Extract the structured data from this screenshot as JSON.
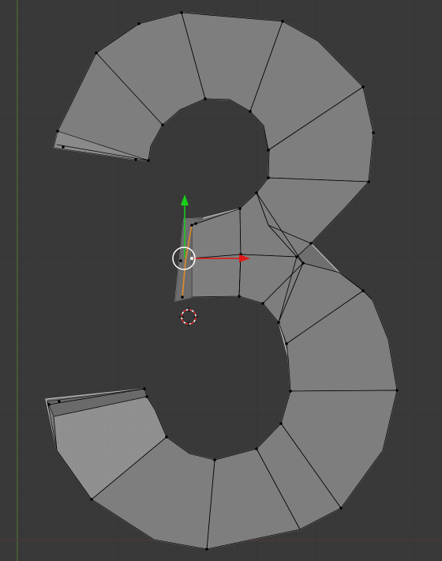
{
  "viewport": {
    "view": "3d-viewport-top-ortho",
    "mode": "edit-mode",
    "object": "digit-3-mesh",
    "colors": {
      "background": "#393939",
      "grid_minor": "#333333",
      "grid_major": "#2e2e2e",
      "y_axis_line": "#5a8a3a",
      "x_axis_line": "#6a3a3a",
      "face_fill": "#7d7d7d",
      "face_shadow": "#6e6e6e",
      "selected_face_fill": "#8e8e8e",
      "edge": "#000000",
      "outline": "#b8b8b8",
      "vertex": "#000000",
      "selected_edge": "#e08a2a",
      "gizmo_x": "#e01818",
      "gizmo_y": "#18d018",
      "pivot_ring": "#ffffff",
      "cursor_ring_red": "#d01010",
      "cursor_ring_white": "#ffffff"
    }
  },
  "icons": {
    "gizmo_x": "move-x-arrow-icon",
    "gizmo_y": "move-y-arrow-icon",
    "pivot": "pivot-circle-icon",
    "cursor": "3d-cursor-icon"
  }
}
